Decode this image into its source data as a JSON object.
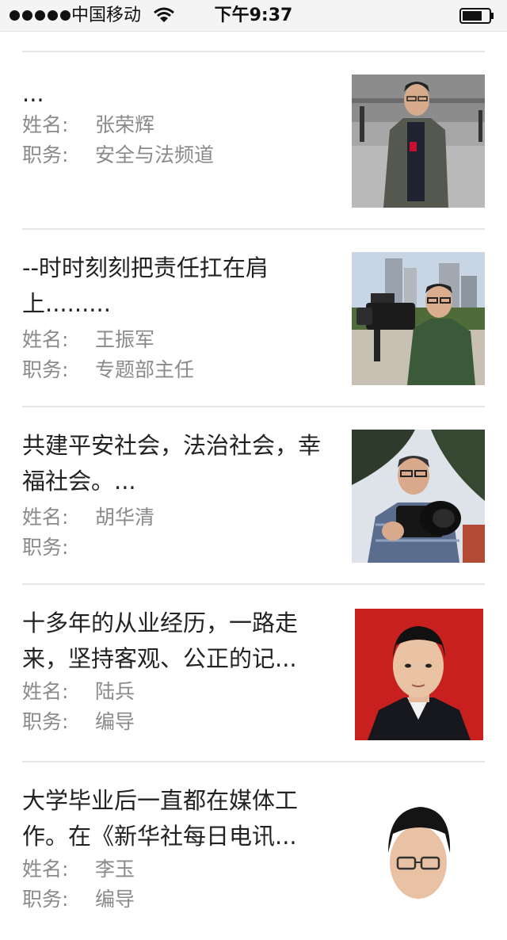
{
  "status_bar": {
    "carrier": "中国移动",
    "time": "下午9:37"
  },
  "labels": {
    "name": "姓名:",
    "position": "职务:"
  },
  "items": [
    {
      "summary": "...",
      "name": "张荣辉",
      "position": "安全与法频道",
      "photo": "man-in-jacket-photo"
    },
    {
      "summary": "--时时刻刻把责任扛在肩上.........",
      "name": "王振军",
      "position": "专题部主任",
      "photo": "cameraman-photo"
    },
    {
      "summary": "共建平安社会，法治社会，幸福社会。...",
      "name": "胡华清",
      "position": "",
      "photo": "photographer-photo"
    },
    {
      "summary": "十多年的从业经历，一路走来，坚持客观、公正的记...",
      "name": "陆兵",
      "position": "编导",
      "photo": "id-portrait-photo"
    },
    {
      "summary": "大学毕业后一直都在媒体工作。在《新华社每日电讯...",
      "name": "李玉",
      "position": "编导",
      "photo": "glasses-portrait-photo"
    }
  ]
}
